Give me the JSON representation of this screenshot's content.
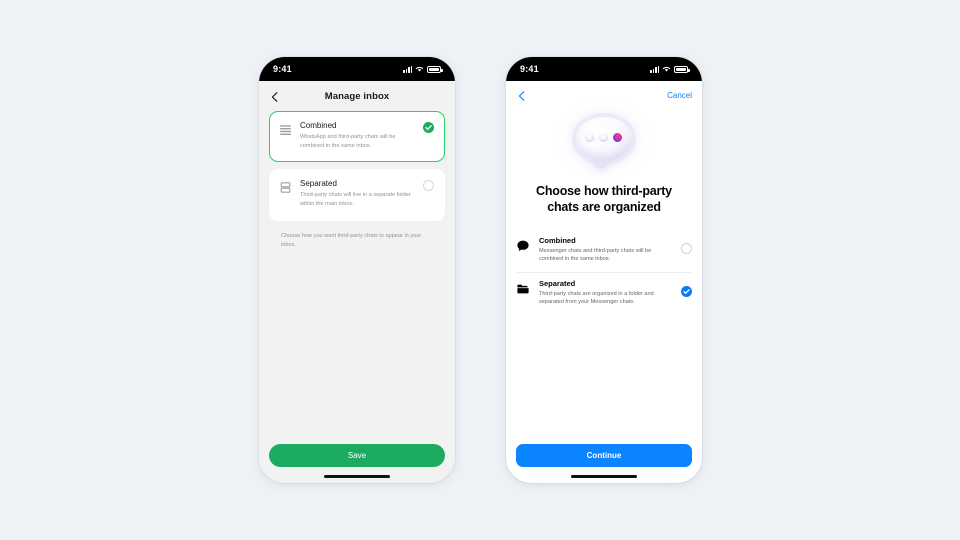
{
  "background_color": "#eef2f6",
  "phones": {
    "left": {
      "name": "manage-inbox-screen",
      "accent_color": "#1daa61",
      "status_bar": {
        "time": "9:41",
        "icons": [
          "signal-icon",
          "wifi-icon",
          "battery-icon"
        ]
      },
      "nav": {
        "back_icon": "chevron-left-icon",
        "title": "Manage inbox"
      },
      "options": [
        {
          "id": "combined",
          "icon": "list-lines-icon",
          "title": "Combined",
          "subtitle": "WhatsApp and third-party chats will be combined in the same inbox.",
          "selected": true
        },
        {
          "id": "separated",
          "icon": "stacked-boxes-icon",
          "title": "Separated",
          "subtitle": "Third-party chats will live in a separate folder within the main inbox.",
          "selected": false
        }
      ],
      "helper_text": "Choose how you want third-party chats to appear in your inbox.",
      "primary_button": {
        "label": "Save",
        "color": "#1daa61"
      }
    },
    "right": {
      "name": "choose-organization-screen",
      "accent_color": "#0a84ff",
      "status_bar": {
        "time": "9:41",
        "icons": [
          "signal-icon",
          "wifi-icon",
          "battery-icon"
        ]
      },
      "nav": {
        "back_icon": "chevron-left-icon",
        "cancel_label": "Cancel"
      },
      "hero_illustration": "speech-bubble-dots-icon",
      "title": "Choose how third-party chats are organized",
      "options": [
        {
          "id": "combined",
          "icon": "speech-bubble-icon",
          "title": "Combined",
          "subtitle": "Messenger chats and third-party chats will be combined in the same inbox.",
          "selected": false
        },
        {
          "id": "separated",
          "icon": "folder-icon",
          "title": "Separated",
          "subtitle": "Third-party chats are organized in a folder and separated from your Messenger chats.",
          "selected": true
        }
      ],
      "primary_button": {
        "label": "Continue",
        "color": "#0a78ff"
      }
    }
  }
}
